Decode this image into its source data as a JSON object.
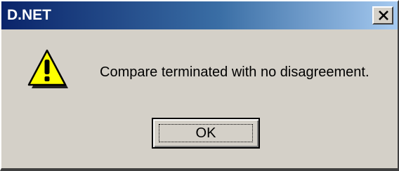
{
  "window": {
    "title": "D.NET"
  },
  "dialog": {
    "icon": "warning-icon",
    "message": "Compare terminated with no disagreement.",
    "ok_label": "OK"
  },
  "colors": {
    "titlebar_start": "#0a246a",
    "titlebar_end": "#a6caf0",
    "face": "#d4d0c8",
    "warning_fill": "#ffff00"
  }
}
